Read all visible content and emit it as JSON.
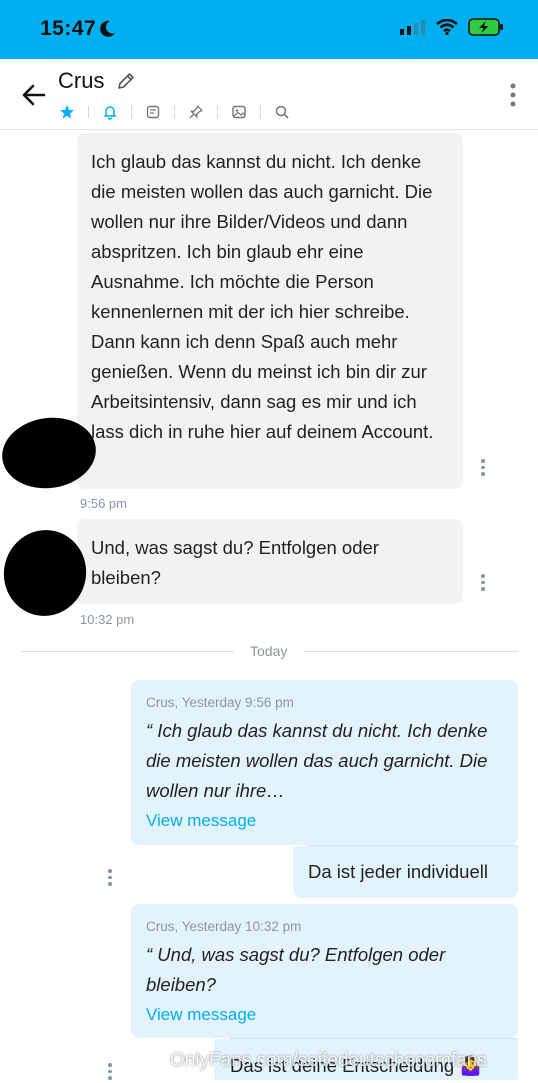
{
  "status_bar": {
    "time": "15:47"
  },
  "header": {
    "title": "Crus"
  },
  "messages_in": [
    {
      "text": "Ich glaub das kannst du nicht. Ich denke die meisten wollen das auch garnicht. Die wollen nur ihre Bilder/Videos und dann abspritzen. Ich bin glaub ehr eine Ausnahme. Ich möchte die Person kennenlernen mit der ich hier schreibe. Dann kann ich denn Spaß auch mehr genießen. Wenn du meinst ich bin dir zur Arbeitsintensiv, dann sag es mir und ich lass dich in ruhe hier auf deinem Account.",
      "time": "9:56 pm"
    },
    {
      "text": "Und, was sagst du? Entfolgen oder bleiben?",
      "time": "10:32 pm"
    }
  ],
  "divider": {
    "label": "Today"
  },
  "messages_out": [
    {
      "quote_meta": "Crus, Yesterday 9:56 pm",
      "quote_text": "“ Ich glaub das kannst du nicht. Ich denke die meisten wollen das auch garnicht. Die wollen nur ihre…",
      "view_label": "View message",
      "reply": "Da ist jeder individuell"
    },
    {
      "quote_meta": "Crus, Yesterday 10:32 pm",
      "quote_text": "“ Und, was sagst du? Entfolgen oder bleiben?",
      "view_label": "View message",
      "reply": "Das ist deine Entscheidung 🤷‍♀️"
    }
  ],
  "watermark": "OnlyFans.com/seifedeutschecomfans",
  "colors": {
    "accent": "#00aff0",
    "incoming_bubble": "#f1f2f4",
    "outgoing_bubble": "#e3f3fc",
    "muted": "#8a96a3"
  }
}
